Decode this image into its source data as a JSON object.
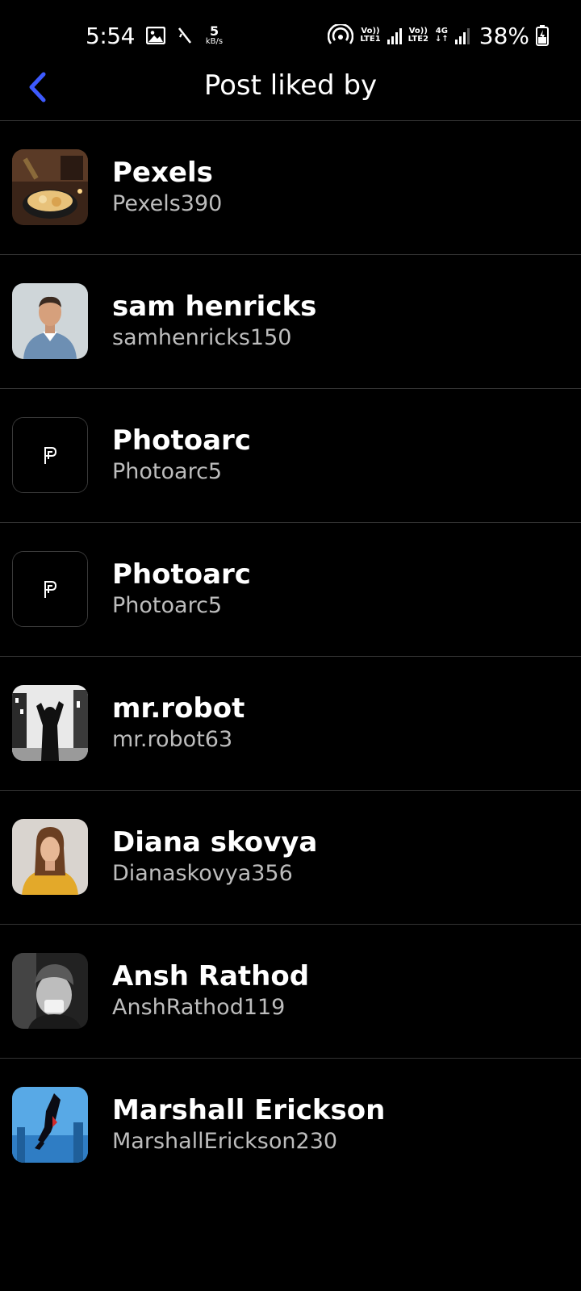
{
  "status_bar": {
    "time": "5:54",
    "speed_value": "5",
    "speed_unit": "kB/s",
    "sim1_top": "Vo))",
    "sim1_bottom": "LTE1",
    "sim2_top": "Vo))",
    "sim2_bottom": "LTE2",
    "network_type": "4G",
    "battery_percent": "38%"
  },
  "header": {
    "title": "Post liked by"
  },
  "likes": [
    {
      "name": "Pexels",
      "username": "Pexels390"
    },
    {
      "name": "sam henricks",
      "username": "samhenricks150"
    },
    {
      "name": "Photoarc",
      "username": "Photoarc5"
    },
    {
      "name": "Photoarc",
      "username": "Photoarc5"
    },
    {
      "name": "mr.robot",
      "username": "mr.robot63"
    },
    {
      "name": "Diana skovya",
      "username": "Dianaskovya356"
    },
    {
      "name": "Ansh Rathod",
      "username": "AnshRathod119"
    },
    {
      "name": "Marshall Erickson",
      "username": "MarshallErickson230"
    }
  ],
  "colors": {
    "background": "#000000",
    "accent": "#3D5AFE",
    "divider": "#333333",
    "secondary_text": "#BDBDBD"
  }
}
